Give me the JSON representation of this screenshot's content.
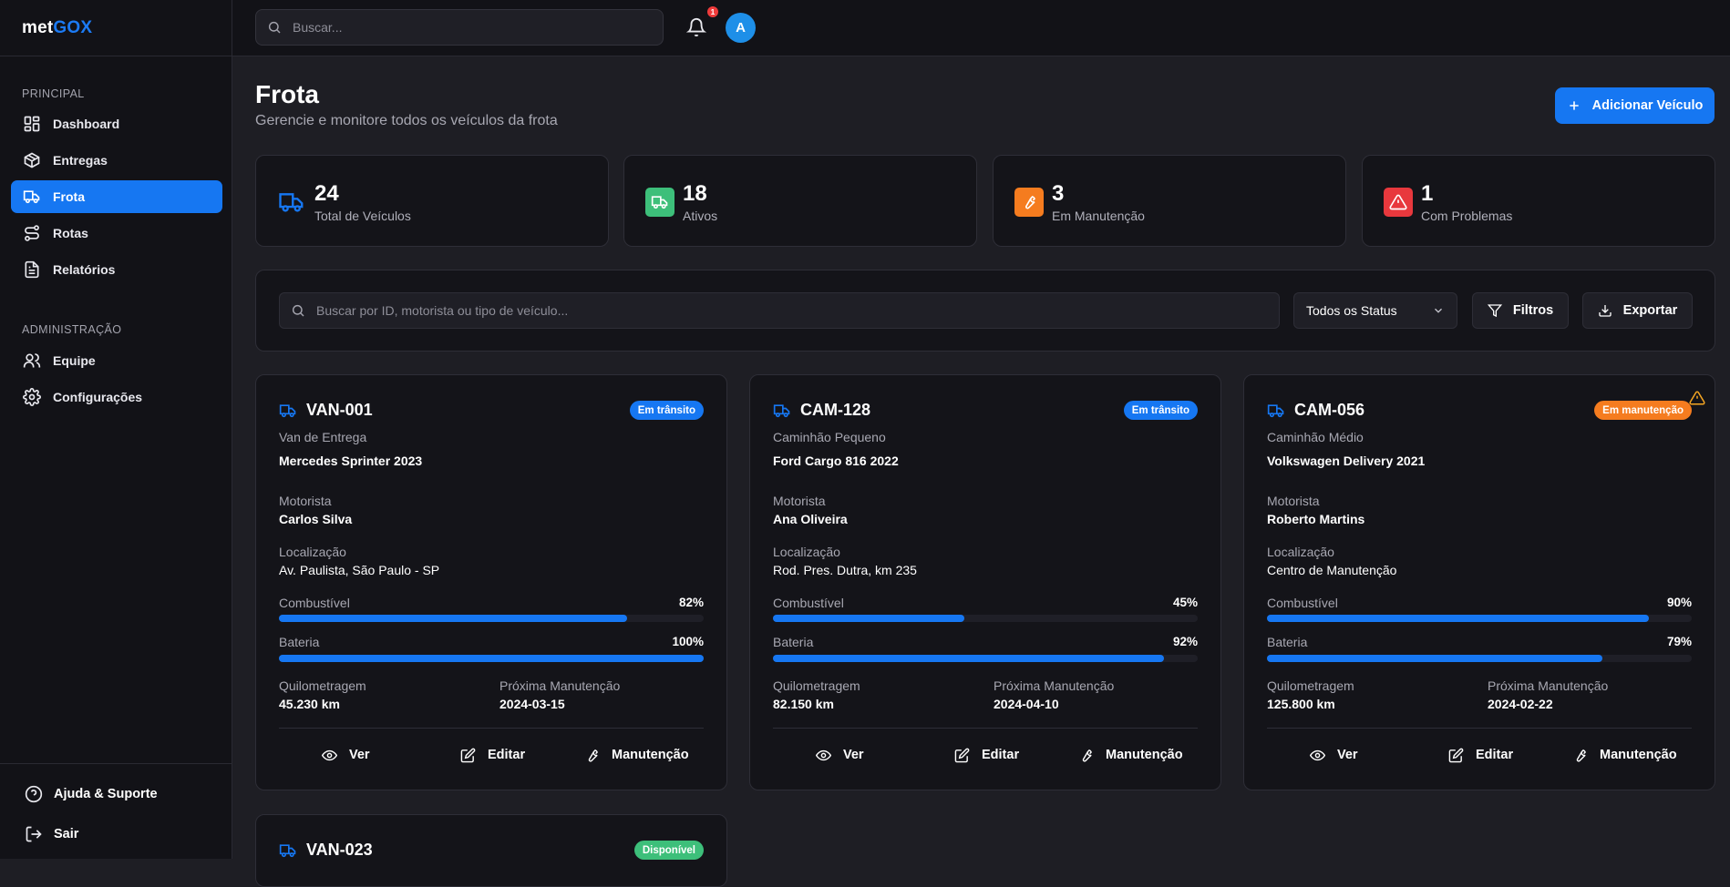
{
  "app": {
    "logo_a": "met",
    "logo_b": "GOX"
  },
  "sidebar": {
    "sections": [
      {
        "title": "PRINCIPAL",
        "items": [
          {
            "label": "Dashboard"
          },
          {
            "label": "Entregas"
          },
          {
            "label": "Frota",
            "active": true
          },
          {
            "label": "Rotas"
          },
          {
            "label": "Relatórios"
          }
        ]
      },
      {
        "title": "ADMINISTRAÇÃO",
        "items": [
          {
            "label": "Equipe"
          },
          {
            "label": "Configurações"
          }
        ]
      }
    ],
    "footer": {
      "help": "Ajuda & Suporte",
      "logout": "Sair"
    }
  },
  "topbar": {
    "search_placeholder": "Buscar...",
    "notifications": "1",
    "avatar": "A"
  },
  "page": {
    "title": "Frota",
    "subtitle": "Gerencie e monitore todos os veículos da frota",
    "add_button": "Adicionar Veículo"
  },
  "stats": [
    {
      "value": "24",
      "label": "Total de Veículos",
      "icon": "truck-icon",
      "color": "#1677f2"
    },
    {
      "value": "18",
      "label": "Ativos",
      "icon": "truck-icon",
      "color": "#3dbf7a"
    },
    {
      "value": "3",
      "label": "Em Manutenção",
      "icon": "wrench-icon",
      "color": "#f57c1f"
    },
    {
      "value": "1",
      "label": "Com Problemas",
      "icon": "alert-icon",
      "color": "#e8383d"
    }
  ],
  "filters": {
    "search_placeholder": "Buscar por ID, motorista ou tipo de veículo...",
    "status_select": "Todos os Status",
    "filters_button": "Filtros",
    "export_button": "Exportar"
  },
  "labels": {
    "driver": "Motorista",
    "location": "Localização",
    "fuel": "Combustível",
    "battery": "Bateria",
    "mileage": "Quilometragem",
    "next_maintenance": "Próxima Manutenção",
    "view": "Ver",
    "edit": "Editar",
    "maintenance": "Manutenção"
  },
  "vehicles": [
    {
      "id": "VAN-001",
      "status": "Em trânsito",
      "status_color": "#1677f2",
      "type": "Van de Entrega",
      "model": "Mercedes Sprinter 2023",
      "driver": "Carlos Silva",
      "location": "Av. Paulista, São Paulo - SP",
      "fuel": 82,
      "fuel_text": "82%",
      "battery": 100,
      "battery_text": "100%",
      "mileage": "45.230 km",
      "next_maintenance": "2024-03-15",
      "warning": false
    },
    {
      "id": "CAM-128",
      "status": "Em trânsito",
      "status_color": "#1677f2",
      "type": "Caminhão Pequeno",
      "model": "Ford Cargo 816 2022",
      "driver": "Ana Oliveira",
      "location": "Rod. Pres. Dutra, km 235",
      "fuel": 45,
      "fuel_text": "45%",
      "battery": 92,
      "battery_text": "92%",
      "mileage": "82.150 km",
      "next_maintenance": "2024-04-10",
      "warning": false
    },
    {
      "id": "CAM-056",
      "status": "Em manutenção",
      "status_color": "#f57c1f",
      "type": "Caminhão Médio",
      "model": "Volkswagen Delivery 2021",
      "driver": "Roberto Martins",
      "location": "Centro de Manutenção",
      "fuel": 90,
      "fuel_text": "90%",
      "battery": 79,
      "battery_text": "79%",
      "mileage": "125.800 km",
      "next_maintenance": "2024-02-22",
      "warning": true
    },
    {
      "id": "VAN-023",
      "status": "Disponível",
      "status_color": "#3dbf7a"
    }
  ]
}
